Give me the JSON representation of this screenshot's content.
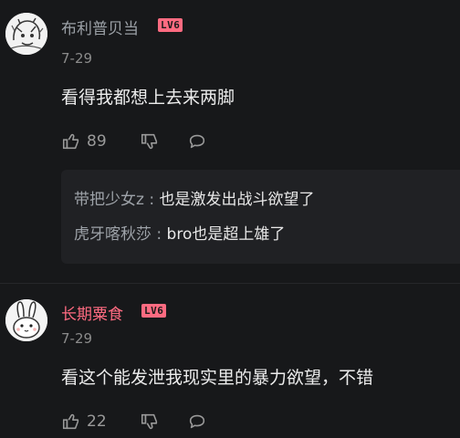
{
  "comments": [
    {
      "username": "布利普贝当",
      "level": "LV6",
      "level_color": "#ff6b81",
      "date": "7-29",
      "text": "看得我都想上去来两脚",
      "likes": "89",
      "replies": [
        {
          "name": "带把少女z",
          "sep": " : ",
          "text": "也是激发出战斗欲望了"
        },
        {
          "name": "虎牙喀秋莎",
          "sep": " : ",
          "text": "bro也是超上雄了"
        }
      ]
    },
    {
      "username": "长期粟食",
      "level": "LV6",
      "level_color": "#ff6b81",
      "date": "7-29",
      "text": "看这个能发泄我现实里的暴力欲望，不错",
      "likes": "22"
    }
  ],
  "icons": {
    "like": "thumbs-up-icon",
    "dislike": "thumbs-down-icon",
    "reply": "comment-bubble-icon"
  }
}
